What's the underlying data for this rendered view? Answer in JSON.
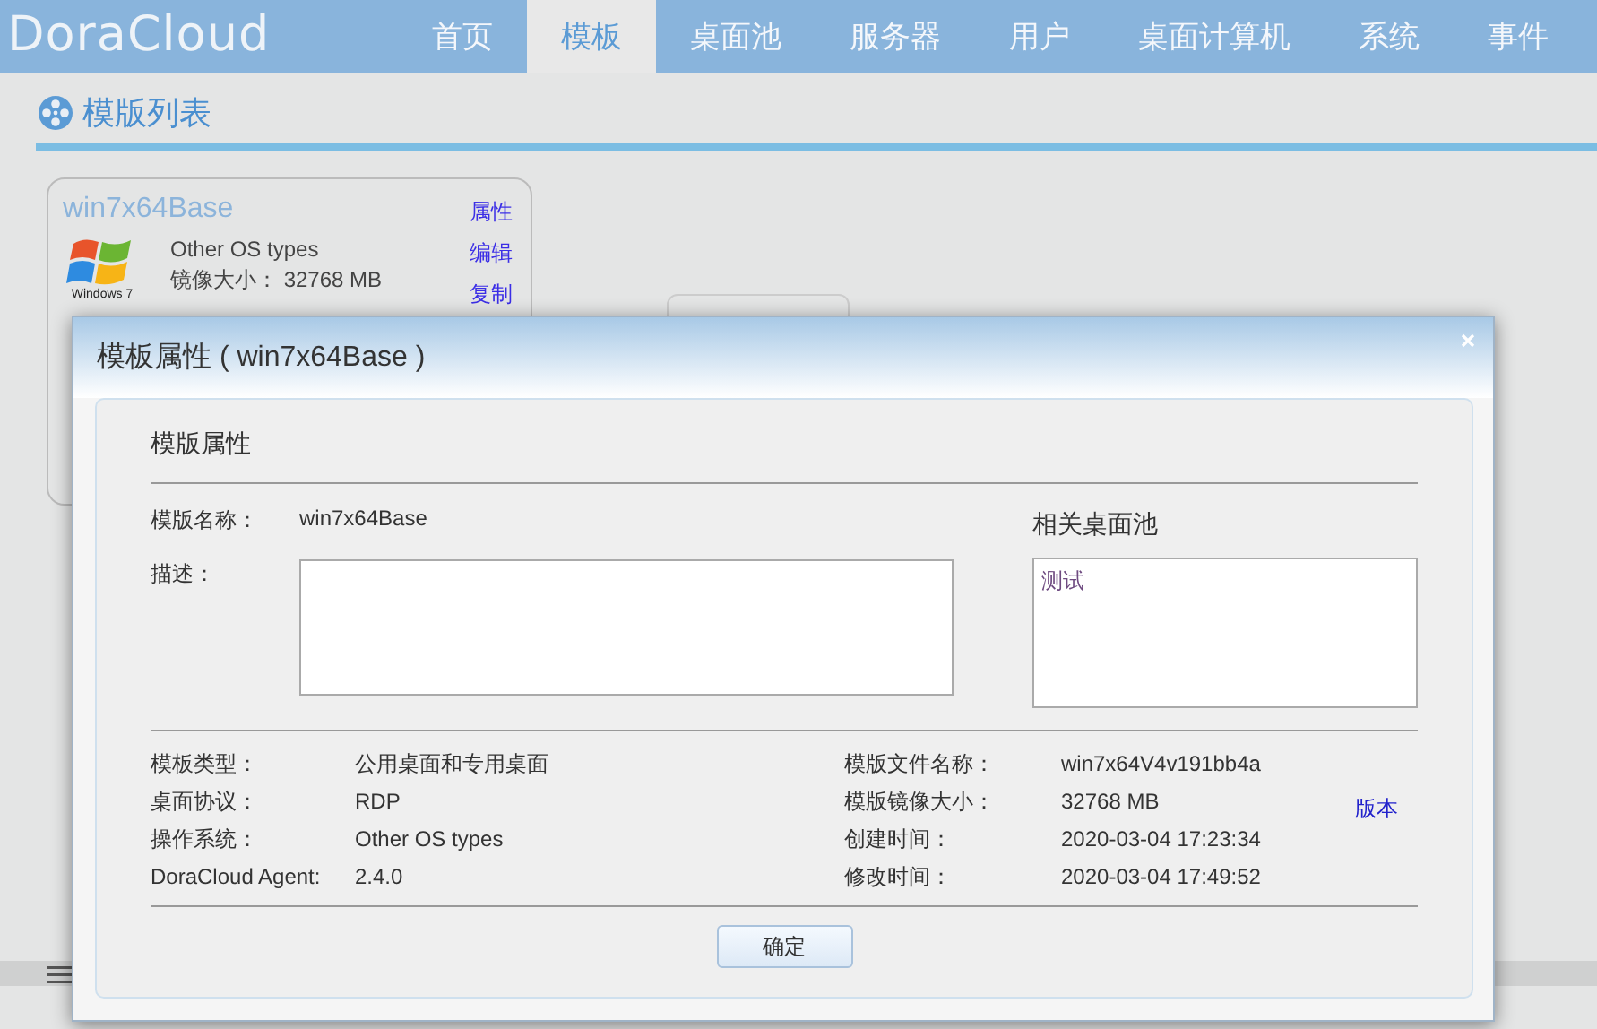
{
  "app": {
    "logo": "DoraCloud"
  },
  "nav": [
    {
      "label": "首页",
      "selected": false
    },
    {
      "label": "模板",
      "selected": true
    },
    {
      "label": "桌面池",
      "selected": false
    },
    {
      "label": "服务器",
      "selected": false
    },
    {
      "label": "用户",
      "selected": false
    },
    {
      "label": "桌面计算机",
      "selected": false
    },
    {
      "label": "系统",
      "selected": false
    },
    {
      "label": "事件",
      "selected": false
    }
  ],
  "section": {
    "title": "模版列表"
  },
  "template_cards": [
    {
      "name": "win7x64Base",
      "logo_caption": "Windows 7",
      "os": "Other OS types",
      "image_size": "镜像大小： 32768 MB",
      "actions": [
        "属性",
        "编辑",
        "复制"
      ]
    }
  ],
  "dialog": {
    "title": "模板属性 ( win7x64Base )",
    "section_title": "模版属性",
    "name_label": "模版名称：",
    "name_value": "win7x64Base",
    "description_label": "描述：",
    "related_pools_title": "相关桌面池",
    "related_pools": [
      "测试"
    ],
    "details_left": [
      {
        "label": "模板类型：",
        "value": "公用桌面和专用桌面"
      },
      {
        "label": "桌面协议：",
        "value": "RDP"
      },
      {
        "label": "操作系统：",
        "value": "Other OS types"
      },
      {
        "label": "DoraCloud Agent:",
        "value": "2.4.0"
      }
    ],
    "details_right": [
      {
        "label": "模版文件名称：",
        "value": "win7x64V4v191bb4a"
      },
      {
        "label": "模版镜像大小：",
        "value": "32768 MB"
      },
      {
        "label": "创建时间：",
        "value": "2020-03-04 17:23:34"
      },
      {
        "label": "修改时间：",
        "value": "2020-03-04 17:49:52"
      }
    ],
    "version_link": "版本",
    "ok_button": "确定"
  }
}
